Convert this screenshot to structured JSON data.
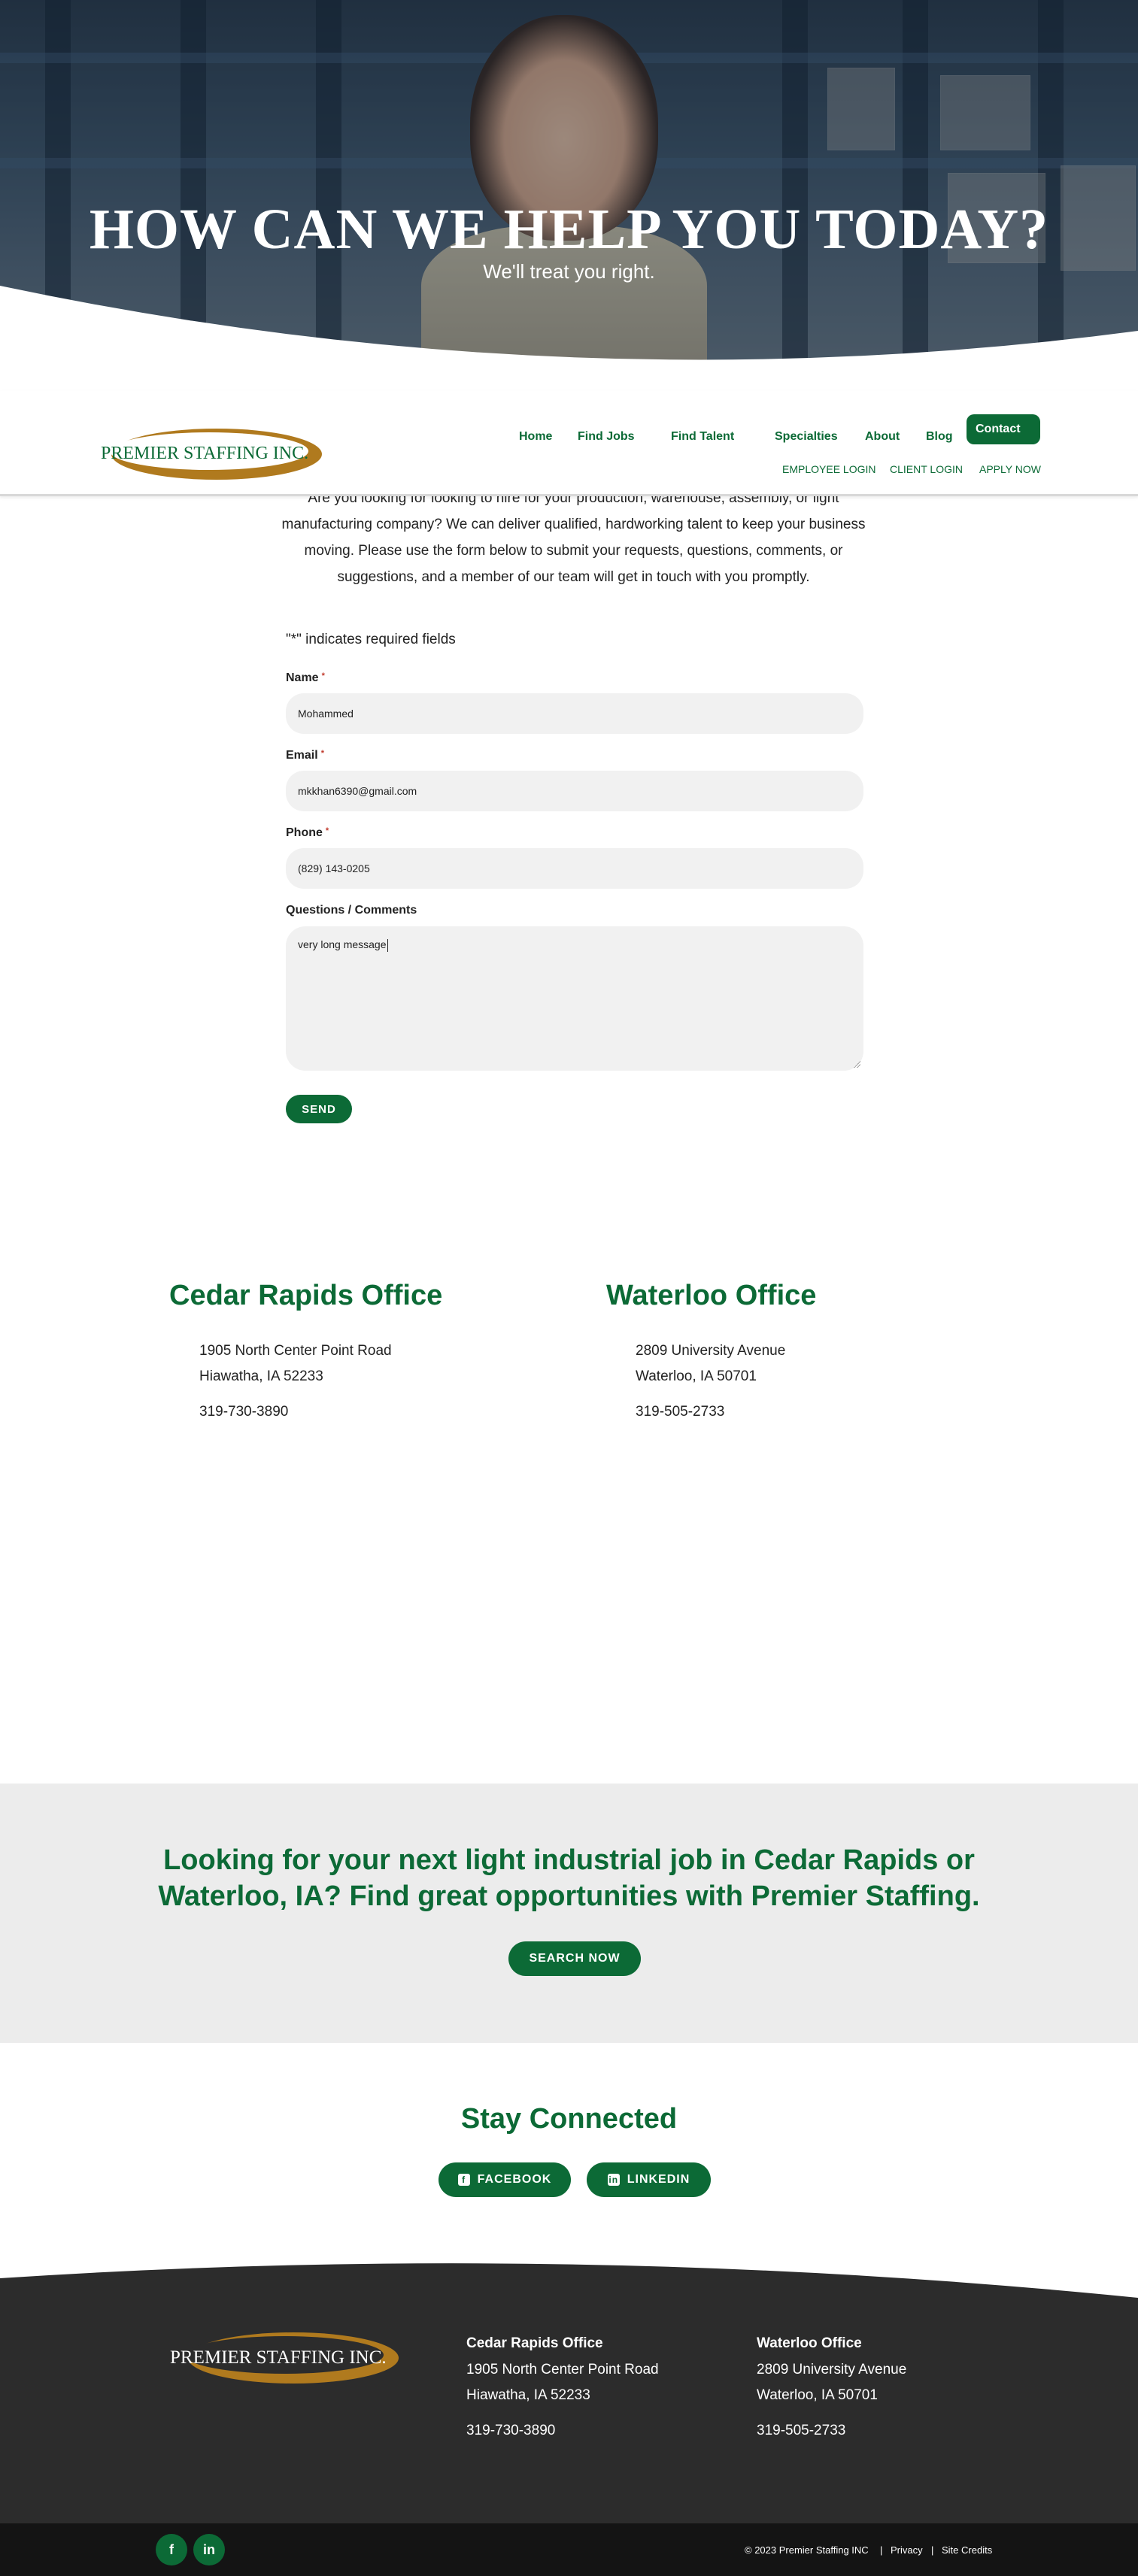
{
  "hero": {
    "title": "HOW CAN WE HELP YOU TODAY?",
    "subtitle": "We'll treat you right."
  },
  "header": {
    "logo_text": "PREMIER STAFFING INC.",
    "nav": [
      "Home",
      "Find Jobs",
      "Find Talent",
      "Specialties",
      "About",
      "Blog",
      "Contact"
    ],
    "subnav": [
      "EMPLOYEE LOGIN",
      "CLIENT LOGIN",
      "APPLY NOW"
    ]
  },
  "form": {
    "intro": "Are you looking for looking to hire for your production, warehouse, assembly, or light manufacturing company? We can deliver qualified, hardworking talent to keep your business moving. Please use the form below to submit your requests, questions, comments, or suggestions, and a member of our team will get in touch with you promptly.",
    "required_note": "\"*\" indicates required fields",
    "required_marker": "*",
    "name_label": "Name",
    "name_value": "Mohammed",
    "email_label": "Email",
    "email_value": "mkkhan6390@gmail.com",
    "phone_label": "Phone",
    "phone_value": "(829) 143-0205",
    "comments_label": "Questions / Comments",
    "comments_value": "very long message",
    "submit_label": "SEND"
  },
  "offices": [
    {
      "title": "Cedar Rapids Office",
      "street": "1905 North Center Point Road",
      "city": "Hiawatha, IA 52233",
      "phone": "319-730-3890"
    },
    {
      "title": "Waterloo Office",
      "street": "2809 University Avenue",
      "city": "Waterloo, IA 50701",
      "phone": "319-505-2733"
    }
  ],
  "cta": {
    "text": "Looking for your next light industrial job in Cedar Rapids or Waterloo, IA? Find great opportunities with Premier Staffing.",
    "button": "SEARCH NOW"
  },
  "social": {
    "title": "Stay Connected",
    "facebook": "FACEBOOK",
    "linkedin": "LINKEDIN"
  },
  "footer": {
    "logo_text": "PREMIER STAFFING INC.",
    "copyright": "© 2023 Premier Staffing INC",
    "separator": "|",
    "privacy": "Privacy",
    "credits": "Site Credits"
  },
  "colors": {
    "brand_green": "#0c6a36",
    "logo_gold": "#b07a1e",
    "footer_bg": "#2c2c2c",
    "bottombar_bg": "#141414",
    "cta_bg": "#ececec"
  }
}
